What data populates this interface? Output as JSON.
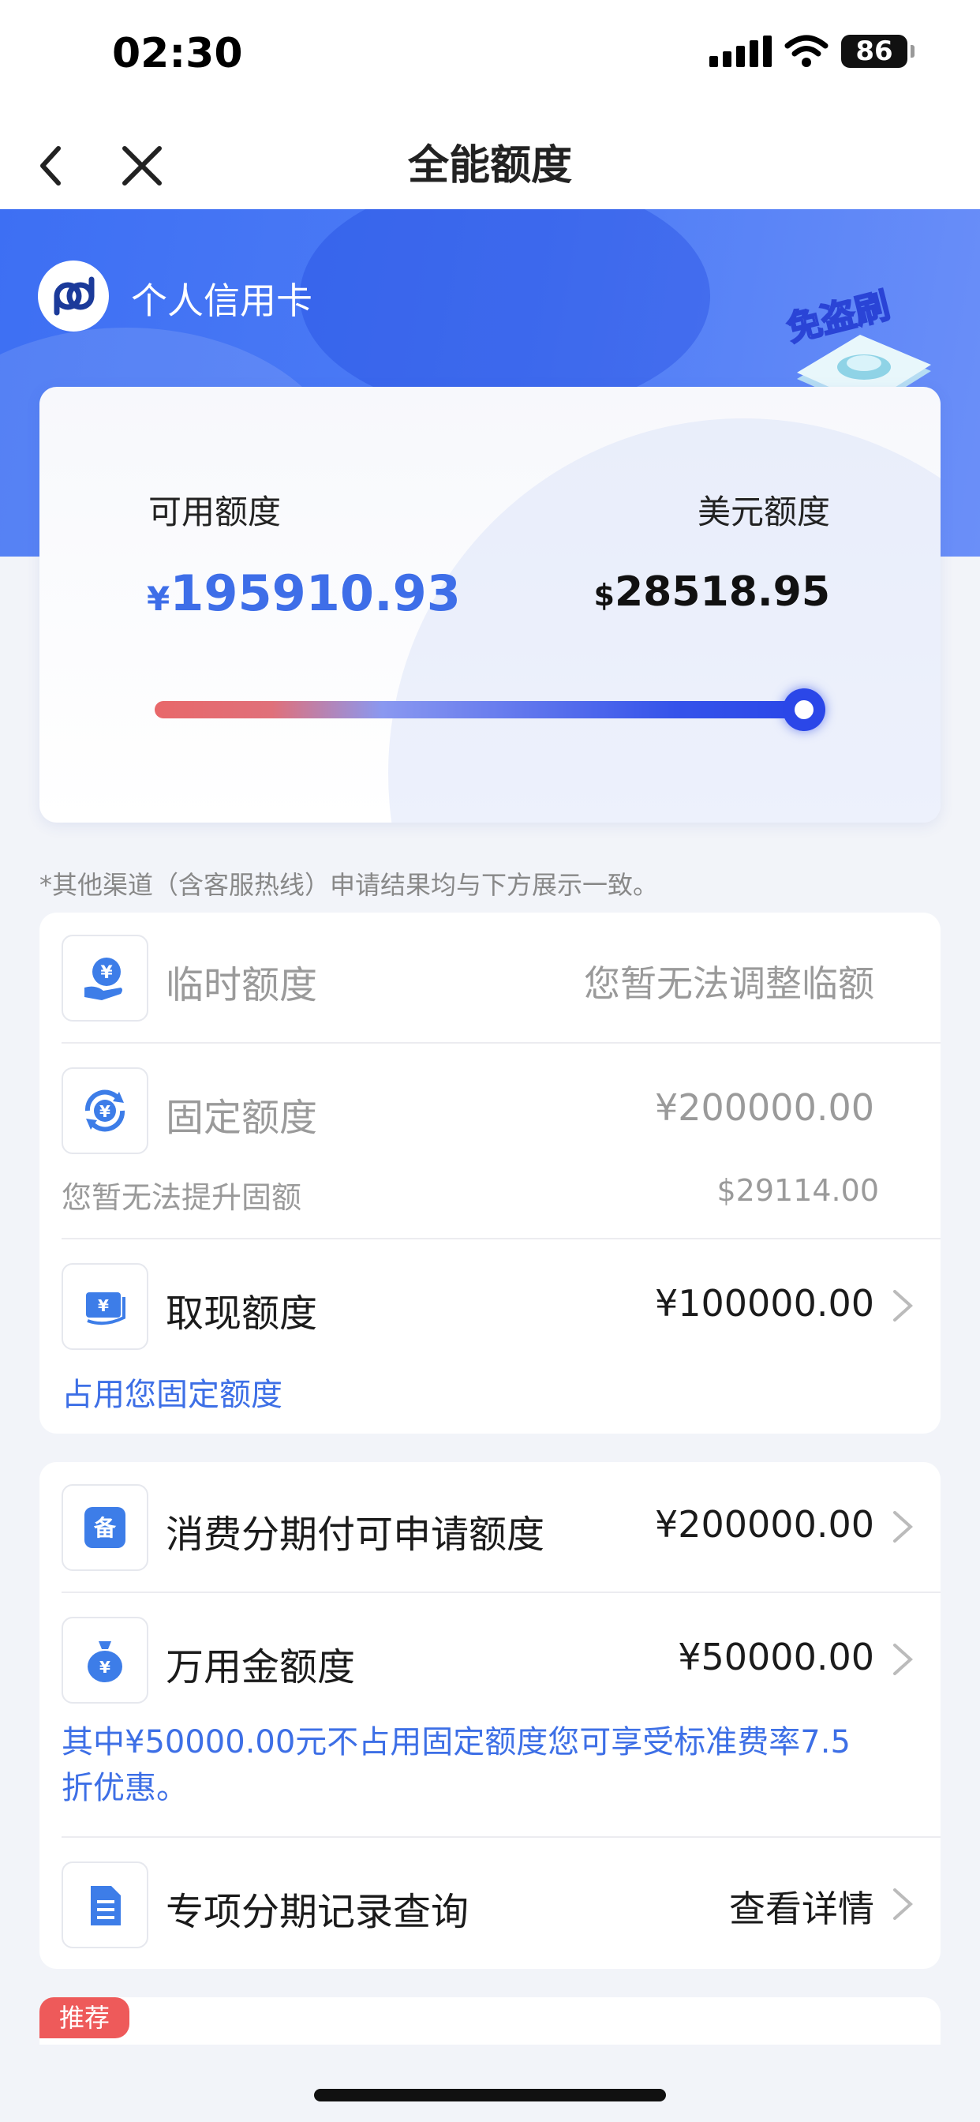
{
  "status_bar": {
    "time": "02:30",
    "battery": "86"
  },
  "nav": {
    "title": "全能额度"
  },
  "card": {
    "name": "个人信用卡",
    "badge_text": "免盗刷"
  },
  "limits": {
    "available_label": "可用额度",
    "available_currency": "¥",
    "available_amount": "195910.93",
    "usd_label": "美元额度",
    "usd_currency": "$",
    "usd_amount": "28518.95",
    "usage_fraction": 0.98
  },
  "notice": "*其他渠道（含客服热线）申请结果均与下方展示一致。",
  "panel1": {
    "temp": {
      "title": "临时额度",
      "value": "您暂无法调整临额",
      "icon": "hand-yuan-icon"
    },
    "fixed": {
      "title": "固定额度",
      "value": "¥200000.00",
      "sub_left": "您暂无法提升固额",
      "sub_right": "$29114.00",
      "icon": "refresh-yuan-icon"
    },
    "cash": {
      "title": "取现额度",
      "value": "¥100000.00",
      "sub": "占用您固定额度",
      "icon": "cash-note-icon"
    }
  },
  "panel2": {
    "installment": {
      "title": "消费分期付可申请额度",
      "value": "¥200000.00",
      "icon": "installment-icon",
      "icon_glyph": "备"
    },
    "wanyong": {
      "title": "万用金额度",
      "value": "¥50000.00",
      "note": "其中¥50000.00元不占用固定额度您可享受标准费率7.5折优惠。",
      "icon": "money-bag-icon"
    },
    "special": {
      "title": "专项分期记录查询",
      "value": "查看详情",
      "icon": "document-icon"
    }
  },
  "panel3": {
    "tag": "推荐"
  },
  "colors": {
    "brand_blue": "#3e6ee8",
    "tag_red": "#ee5a5a"
  }
}
